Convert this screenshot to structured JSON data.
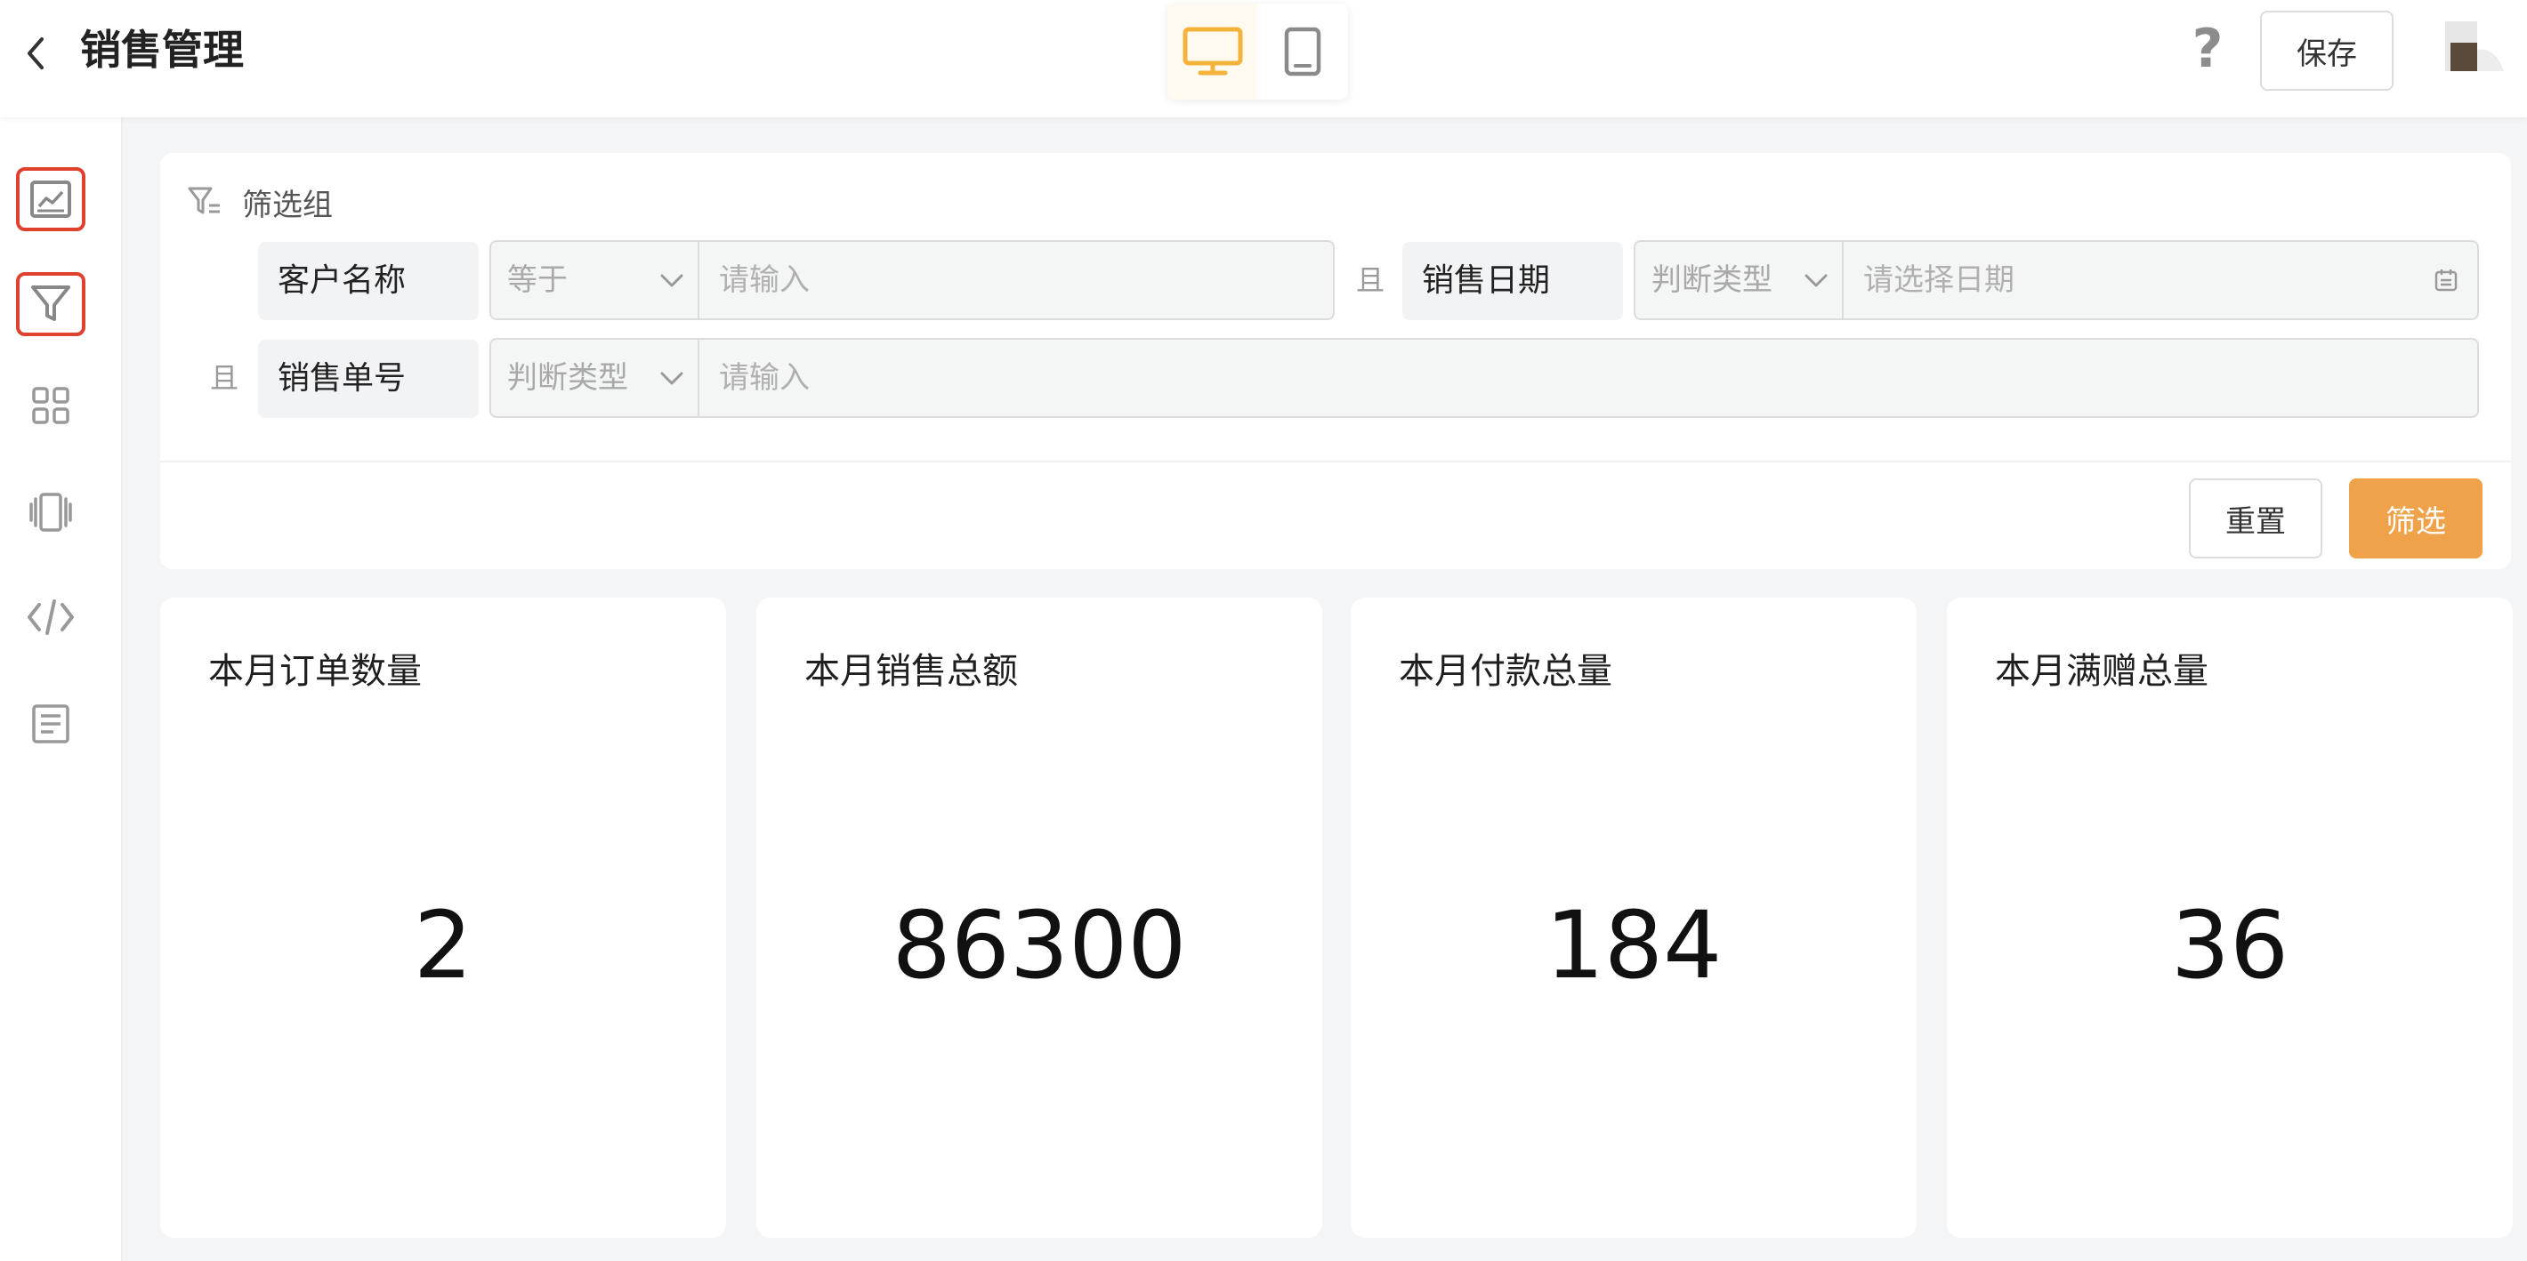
{
  "header": {
    "title": "销售管理",
    "save_label": "保存",
    "help_symbol": "?"
  },
  "device_switch": {
    "active": "desktop",
    "accent_color": "#f3b23a"
  },
  "sidebar": {
    "items": [
      {
        "icon": "chart-panel-icon",
        "marked": true
      },
      {
        "icon": "filter-icon",
        "marked": true
      },
      {
        "icon": "grid-icon",
        "marked": false
      },
      {
        "icon": "carousel-icon",
        "marked": false
      },
      {
        "icon": "code-icon",
        "marked": false
      },
      {
        "icon": "document-icon",
        "marked": false
      }
    ],
    "marker_color": "#e0412f"
  },
  "filter_group": {
    "title": "筛选组",
    "conditions": [
      {
        "field": "客户名称",
        "operator": "等于",
        "placeholder": "请输入"
      },
      {
        "conjunction": "且",
        "field": "销售日期",
        "operator": "判断类型",
        "placeholder": "请选择日期"
      },
      {
        "conjunction": "且",
        "field": "销售单号",
        "operator": "判断类型",
        "placeholder": "请输入"
      }
    ],
    "reset_label": "重置",
    "submit_label": "筛选",
    "submit_color": "#f0a24a"
  },
  "stats": [
    {
      "title": "本月订单数量",
      "value": "2"
    },
    {
      "title": "本月销售总额",
      "value": "86300"
    },
    {
      "title": "本月付款总量",
      "value": "184"
    },
    {
      "title": "本月满赠总量",
      "value": "36"
    }
  ]
}
